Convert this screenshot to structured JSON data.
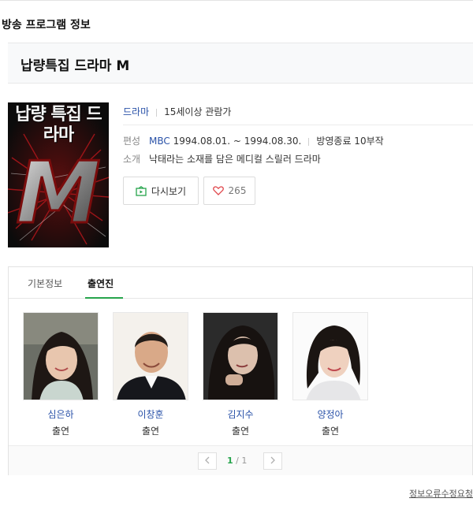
{
  "section_title": "방송 프로그램 정보",
  "program": {
    "title": "납량특집 드라마 M",
    "poster_text": "납량 특집 드라마",
    "poster_letter": "M"
  },
  "info": {
    "genre": "드라마",
    "rating": "15세이상 관람가",
    "schedule_label": "편성",
    "channel": "MBC",
    "air_dates": "1994.08.01. ~ 1994.08.30.",
    "status": "방영종료 10부작",
    "summary_label": "소개",
    "summary": "낙태라는 소재를 담은 메디컬 스릴러 드라마"
  },
  "buttons": {
    "replay_label": "다시보기",
    "like_count": "265"
  },
  "tabs": {
    "basic": "기본정보",
    "cast": "출연진"
  },
  "cast": [
    {
      "name": "심은하",
      "role": "출연"
    },
    {
      "name": "이창훈",
      "role": "출연"
    },
    {
      "name": "김지수",
      "role": "출연"
    },
    {
      "name": "양정아",
      "role": "출연"
    }
  ],
  "pagination": {
    "current": "1",
    "separator": "/",
    "total": "1"
  },
  "report_link": "정보오류수정요청",
  "colors": {
    "link": "#2a52a8",
    "accent_green": "#26a44c"
  }
}
